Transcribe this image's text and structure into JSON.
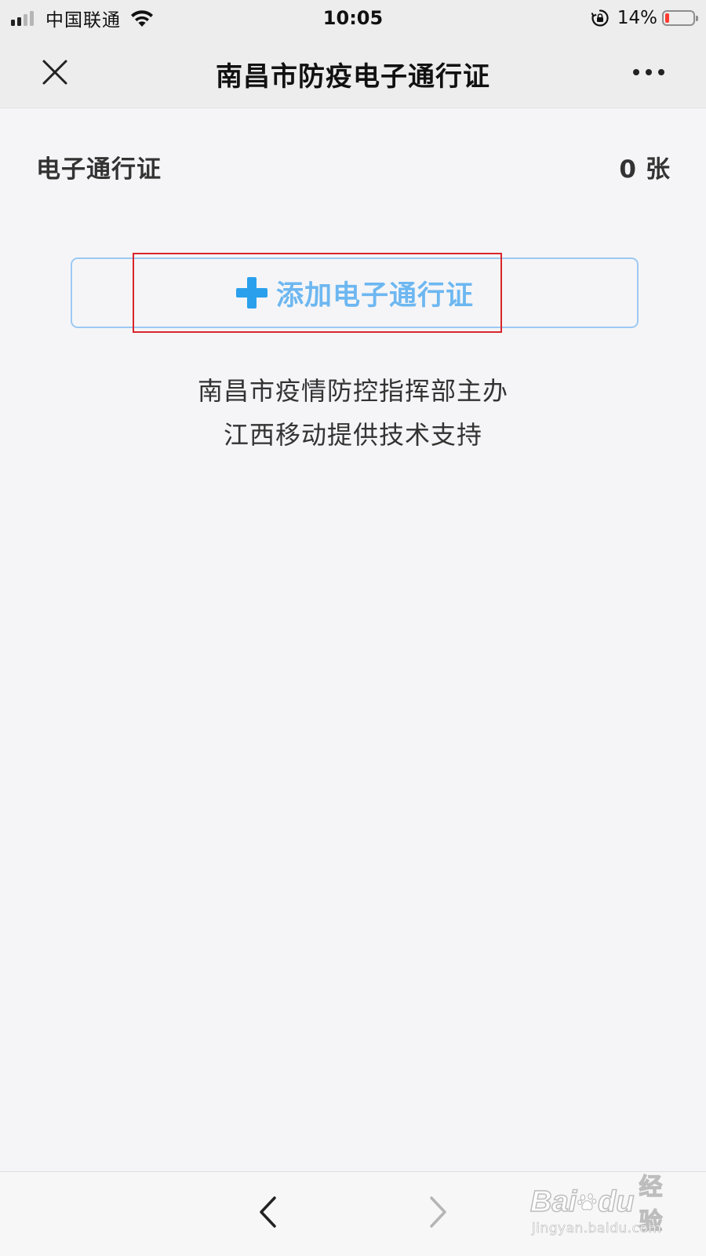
{
  "status_bar": {
    "carrier": "中国联通",
    "time": "10:05",
    "battery_percent": "14%",
    "battery_level": 0.14,
    "signal_bars_active": 2,
    "signal_bars_total": 4,
    "icons": [
      "signal-icon",
      "wifi-icon",
      "rotation-lock-icon",
      "battery-icon"
    ]
  },
  "nav_bar": {
    "title": "南昌市防疫电子通行证",
    "close_icon": "close-icon",
    "more_icon": "more-icon"
  },
  "pass_summary": {
    "label": "电子通行证",
    "count": "0",
    "unit": "张"
  },
  "add_button": {
    "label": "添加电子通行证",
    "icon": "plus-icon"
  },
  "footer": {
    "line1": "南昌市疫情防控指挥部主办",
    "line2": "江西移动提供技术支持"
  },
  "bottom_toolbar": {
    "back_icon": "back-icon",
    "forward_icon": "forward-icon"
  },
  "watermark": {
    "brand_part1": "Bai",
    "brand_part2": "du",
    "product": "经验",
    "url": "jingyan.baidu.com"
  },
  "colors": {
    "accent_blue": "#6db7f1",
    "plus_blue": "#2aa0ec",
    "button_border": "#9cc9f3",
    "highlight_red": "#d8262b",
    "battery_low": "#ff3b30",
    "background": "#f5f5f7",
    "header_bg": "#ededed"
  }
}
